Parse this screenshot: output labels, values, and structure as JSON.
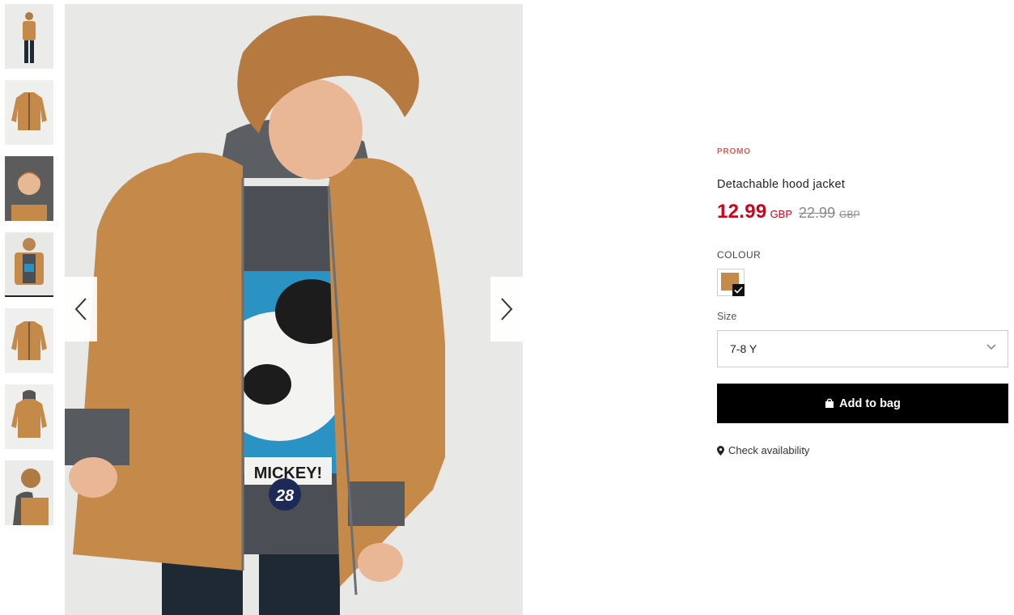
{
  "gallery": {
    "thumbnails": [
      {
        "name": "thumb-full-body-front"
      },
      {
        "name": "thumb-jacket-flat-front"
      },
      {
        "name": "thumb-hood-closeup"
      },
      {
        "name": "thumb-model-wearing",
        "active": true
      },
      {
        "name": "thumb-jacket-flat-plain"
      },
      {
        "name": "thumb-jacket-flat-hood"
      },
      {
        "name": "thumb-model-side"
      }
    ],
    "prev_icon": "chevron-left-icon",
    "next_icon": "chevron-right-icon",
    "photo": {
      "tshirt_text": "MICKEY!",
      "badge_text": "28"
    }
  },
  "product": {
    "promo_label": "PROMO",
    "title": "Detachable hood jacket",
    "price_now": "12.99",
    "currency_now": "GBP",
    "price_old": "22.99",
    "currency_old": "GBP",
    "colour_label": "COLOUR",
    "selected_colour": "#c58a4a",
    "size_label": "Size",
    "selected_size": "7-8 Y",
    "add_to_bag_label": "Add to bag",
    "check_availability_label": "Check availability"
  },
  "colors": {
    "price_red": "#d0021b",
    "promo_red": "#e05a4f",
    "button_black": "#000000",
    "jacket_tan": "#c58a4a"
  }
}
